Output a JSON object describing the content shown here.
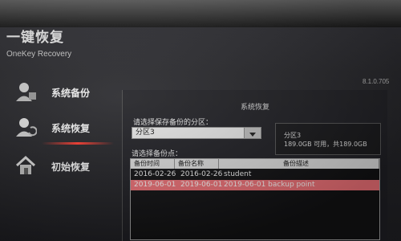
{
  "app": {
    "title": "一键恢复",
    "subtitle": "OneKey Recovery",
    "version": "8.1.0.705"
  },
  "sidebar": {
    "items": [
      {
        "label": "系统备份",
        "icon": "backup-user-icon",
        "active": false
      },
      {
        "label": "系统恢复",
        "icon": "recovery-user-icon",
        "active": true
      },
      {
        "label": "初始恢复",
        "icon": "home-restore-icon",
        "active": false
      }
    ]
  },
  "panel": {
    "title": "系统恢复",
    "partition_prompt": "请选择保存备份的分区：",
    "partition_selected": "分区3",
    "partition_info_name": "分区3",
    "partition_info_space": "189.0GB 可用，共189.0GB",
    "backup_prompt": "请选择备份点：",
    "table": {
      "headers": [
        "备份时间",
        "备份名称",
        "备份描述"
      ],
      "rows": [
        {
          "time": "2016-02-26",
          "name": "2016-02-26",
          "desc": "student",
          "selected": false
        },
        {
          "time": "2019-06-01",
          "name": "2019-06-01",
          "desc": "2019-06-01 backup point",
          "selected": true
        }
      ]
    }
  },
  "colors": {
    "accent": "#ff3b2f",
    "selected_row": "#e86e74"
  }
}
